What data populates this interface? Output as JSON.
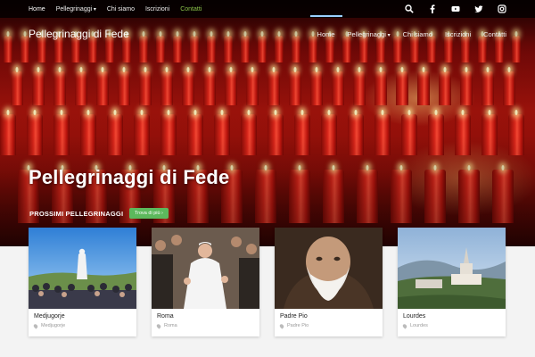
{
  "topbar": {
    "nav": [
      {
        "label": "Home"
      },
      {
        "label": "Pellegrinaggi"
      },
      {
        "label": "Chi siamo"
      },
      {
        "label": "Iscrizioni"
      },
      {
        "label": "Contatti"
      }
    ],
    "icons": [
      "search-icon",
      "facebook-icon",
      "youtube-icon",
      "twitter-icon",
      "instagram-icon"
    ]
  },
  "header": {
    "brand": "Pellegrinaggi di Fede",
    "nav": [
      {
        "label": "Home"
      },
      {
        "label": "Pellegrinaggi"
      },
      {
        "label": "Chi siamo"
      },
      {
        "label": "Iscrizioni"
      },
      {
        "label": "Contatti"
      }
    ]
  },
  "hero": {
    "title": "Pellegrinaggi di Fede"
  },
  "section": {
    "label": "PROSSIMI PELLEGRINAGGI",
    "button": "Trova di più ›"
  },
  "cards": [
    {
      "title": "Medjugorje",
      "location": "Medjugorje"
    },
    {
      "title": "Roma",
      "location": "Roma"
    },
    {
      "title": "Padre Pio",
      "location": "Padre Pio"
    },
    {
      "title": "Lourdes",
      "location": "Lourdes"
    }
  ],
  "colors": {
    "accent_green": "#5cb85c",
    "active_underline": "#9bd0ff",
    "topbar_bg": "#000000"
  }
}
